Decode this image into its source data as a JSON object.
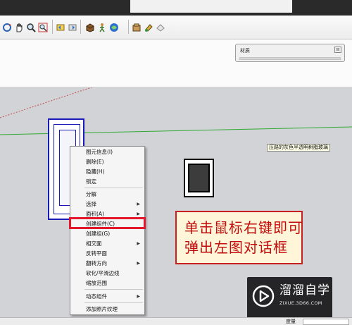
{
  "toolbar": {
    "icons": [
      "orbit-icon",
      "pan-icon",
      "zoom-icon",
      "zoom-extents-icon",
      "previous-view-icon",
      "next-view-icon",
      "component-icon",
      "walk-icon",
      "position-camera-icon",
      "shadow-icon",
      "paint-icon",
      "section-icon"
    ]
  },
  "materials_panel": {
    "title": "材质",
    "close_glyph": "⊟"
  },
  "tooltip": {
    "text": "压路的灰色半透明树脂玻璃"
  },
  "context_menu": {
    "items": [
      {
        "label": "图元信息(I)",
        "submenu": false
      },
      {
        "label": "删除(E)",
        "submenu": false
      },
      {
        "label": "隐藏(H)",
        "submenu": false
      },
      {
        "label": "锁定",
        "submenu": false
      },
      {
        "label": "分解",
        "submenu": false
      },
      {
        "label": "选择",
        "submenu": true
      },
      {
        "label": "面积(A)",
        "submenu": true
      },
      {
        "label": "创建组件(C)",
        "submenu": false,
        "highlighted": true
      },
      {
        "label": "创建组(G)",
        "submenu": false
      },
      {
        "label": "相交面",
        "submenu": true
      },
      {
        "label": "反转平面",
        "submenu": false
      },
      {
        "label": "翻转方向",
        "submenu": true
      },
      {
        "label": "软化/平滑边线",
        "submenu": false
      },
      {
        "label": "缩放范围",
        "submenu": false
      },
      {
        "label": "动态组件",
        "submenu": true
      },
      {
        "label": "添加照片纹理",
        "submenu": false
      }
    ],
    "arrow_glyph": "▶"
  },
  "callout": {
    "line1": "单击鼠标右键即可",
    "line2": "弹出左图对话框"
  },
  "watermark": {
    "name": "溜溜自学",
    "url": "ZIXUE.3D66.COM"
  },
  "statusbar": {
    "label": "度量"
  },
  "colors": {
    "highlight_border": "#e3182a",
    "callout_text": "#c20b0b",
    "selection_blue": "#1a1ab8",
    "axis_green": "#2faa2f",
    "axis_red": "#c0504d"
  }
}
